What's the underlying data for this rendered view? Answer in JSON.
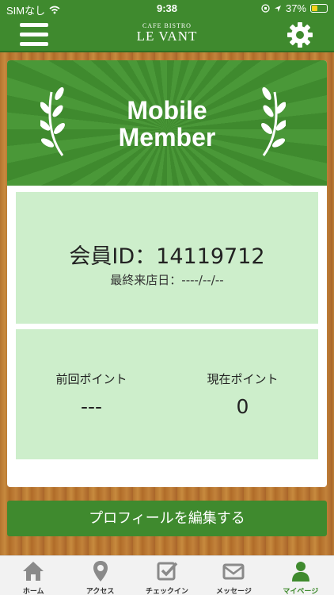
{
  "status": {
    "carrier": "SIMなし",
    "time": "9:38",
    "battery": "37%"
  },
  "header": {
    "logo_small": "CAFE BISTRO",
    "logo_big": "LE VANT"
  },
  "banner": {
    "title_line1": "Mobile",
    "title_line2": "Member"
  },
  "member": {
    "id_text": "会員ID：14119712",
    "last_visit": "最終来店日：----/--/--"
  },
  "points": {
    "previous_label": "前回ポイント",
    "previous_value": "---",
    "current_label": "現在ポイント",
    "current_value": "0"
  },
  "profile_button": "プロフィールを編集する",
  "tabs": [
    {
      "label": "ホーム",
      "icon": "home-icon"
    },
    {
      "label": "アクセス",
      "icon": "map-pin-icon"
    },
    {
      "label": "チェックイン",
      "icon": "checkin-icon"
    },
    {
      "label": "メッセージ",
      "icon": "mail-icon"
    },
    {
      "label": "マイページ",
      "icon": "person-icon"
    }
  ],
  "colors": {
    "brand_green": "#3f8a2e",
    "panel_green": "#cdeecb",
    "wood": "#b5742f"
  }
}
